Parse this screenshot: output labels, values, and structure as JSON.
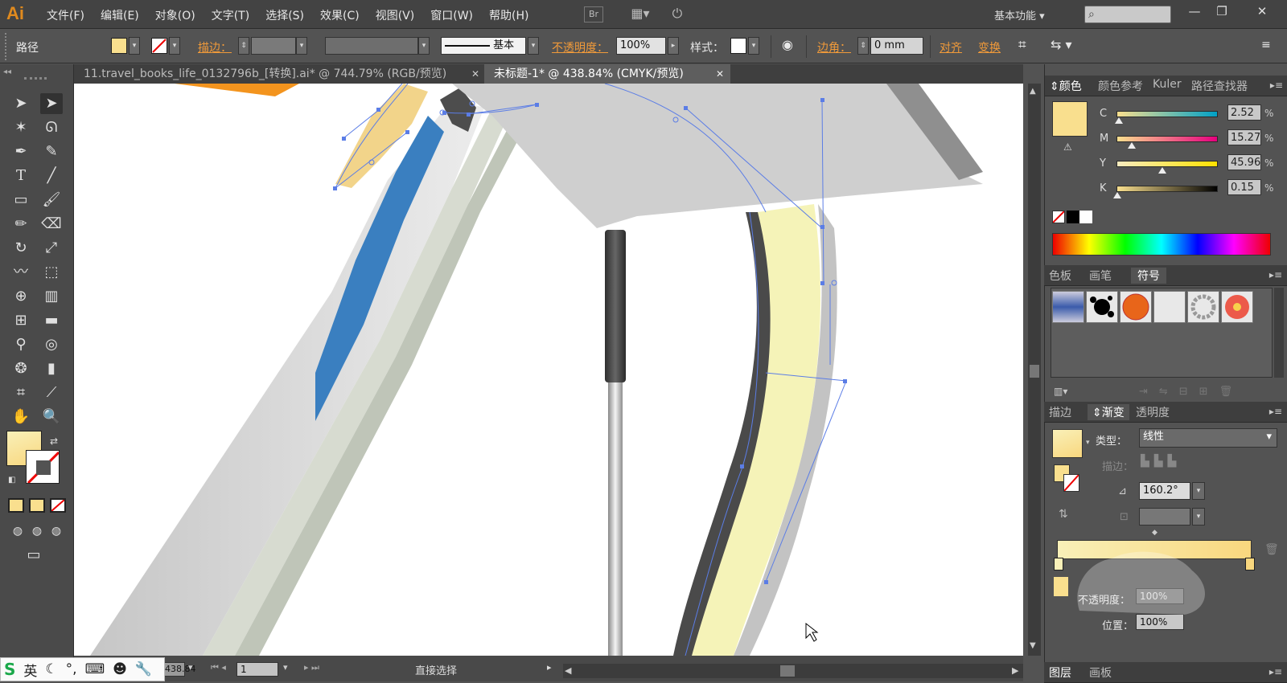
{
  "app": {
    "logo": "Ai"
  },
  "menu": [
    "文件(F)",
    "编辑(E)",
    "对象(O)",
    "文字(T)",
    "选择(S)",
    "效果(C)",
    "视图(V)",
    "窗口(W)",
    "帮助(H)"
  ],
  "menubar": {
    "bridge_label": "Br",
    "workspace": "基本功能",
    "search_icon": "search-icon"
  },
  "window_controls": {
    "minimize": "—",
    "restore": "❐",
    "close": "✕"
  },
  "control_bar": {
    "selection_type": "路径",
    "stroke_label": "描边：",
    "stroke_profile": "基本",
    "opacity_label": "不透明度：",
    "opacity_value": "100%",
    "style_label": "样式：",
    "corner_label": "边角：",
    "corner_value": "0 mm",
    "align_label": "对齐",
    "transform_label": "变换",
    "fill_color": "#f9df8e"
  },
  "tabs": [
    {
      "label": "11.travel_books_life_0132796b_[转换].ai* @ 744.79% (RGB/预览)",
      "active": false
    },
    {
      "label": "未标题-1* @ 438.84% (CMYK/预览)",
      "active": true
    }
  ],
  "tools": [
    "selection-arrow",
    "direct-select",
    "magic-wand",
    "lasso",
    "pen",
    "curvature",
    "type",
    "line",
    "rectangle",
    "paintbrush",
    "pencil",
    "eraser",
    "rotate",
    "scale",
    "warp",
    "free-transform",
    "shape-builder",
    "graph",
    "mesh",
    "gradient",
    "eyedropper",
    "blend",
    "symbol-sprayer",
    "column-graph",
    "artboard",
    "slice",
    "hand",
    "zoom"
  ],
  "status_bar": {
    "zoom": "438.84",
    "page": "1",
    "tool": "直接选择"
  },
  "color_panel": {
    "tabs": [
      "颜色",
      "颜色参考",
      "Kuler",
      "路径查找器"
    ],
    "swatch": "#f9df8e",
    "channels": [
      {
        "label": "C",
        "value": "2.52",
        "pct": 0.025,
        "from": "#f9df8e",
        "to": "#00a0c6"
      },
      {
        "label": "M",
        "value": "15.27",
        "pct": 0.153,
        "from": "#f9df8e",
        "to": "#e5007e"
      },
      {
        "label": "Y",
        "value": "45.96",
        "pct": 0.46,
        "from": "#f9ecc0",
        "to": "#ffe100"
      },
      {
        "label": "K",
        "value": "0.15",
        "pct": 0.0,
        "from": "#f9df8e",
        "to": "#000000"
      }
    ],
    "unit": "%"
  },
  "symbol_panel": {
    "tabs": [
      "色板",
      "画笔",
      "符号"
    ]
  },
  "gradient_panel": {
    "tabs": [
      "描边",
      "渐变",
      "透明度"
    ],
    "type_label": "类型：",
    "type_value": "线性",
    "stroke_label": "描边：",
    "angle_value": "160.2°",
    "gradient_from": "#f9f0b8",
    "gradient_to": "#f9d77e",
    "opacity_label": "不透明度：",
    "opacity_value": "100%",
    "position_label": "位置：",
    "position_value": "100%"
  },
  "layers_panel": {
    "tabs": [
      "图层",
      "画板"
    ]
  },
  "ime": {
    "lang": "英"
  }
}
